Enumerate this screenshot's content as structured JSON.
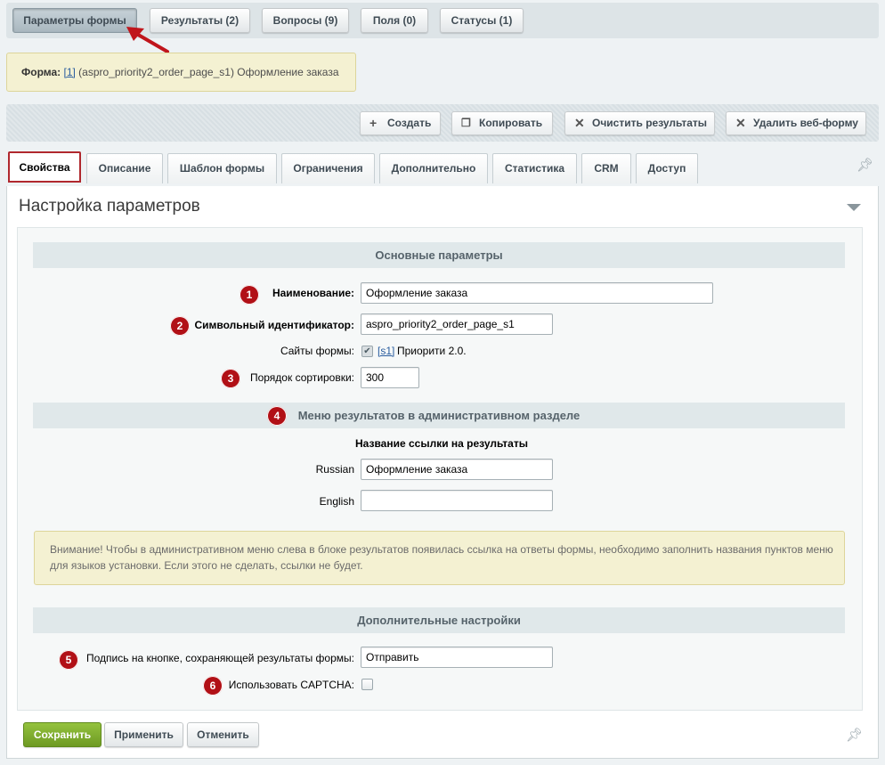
{
  "top_tabs": [
    {
      "label": "Параметры формы",
      "active": true
    },
    {
      "label": "Результаты (2)"
    },
    {
      "label": "Вопросы (9)"
    },
    {
      "label": "Поля (0)"
    },
    {
      "label": "Статусы (1)"
    }
  ],
  "form_info": {
    "prefix": "Форма:",
    "id_link": "[1]",
    "text": "(aspro_priority2_order_page_s1) Оформление заказа"
  },
  "toolbar": {
    "create": "Создать",
    "copy": "Копировать",
    "clear_results": "Очистить результаты",
    "delete_form": "Удалить веб-форму"
  },
  "tabs": [
    {
      "label": "Свойства",
      "active": true
    },
    {
      "label": "Описание"
    },
    {
      "label": "Шаблон формы"
    },
    {
      "label": "Ограничения"
    },
    {
      "label": "Дополнительно"
    },
    {
      "label": "Статистика"
    },
    {
      "label": "CRM"
    },
    {
      "label": "Доступ"
    }
  ],
  "panel_title": "Настройка параметров",
  "sections": {
    "main": "Основные параметры",
    "menu": "Меню результатов в административном разделе",
    "extra": "Дополнительные настройки"
  },
  "fields": {
    "name_label": "Наименование:",
    "name_value": "Оформление заказа",
    "sid_label": "Символьный идентификатор:",
    "sid_value": "aspro_priority2_order_page_s1",
    "sites_label": "Сайты формы:",
    "site_link": "[s1]",
    "site_name": "Приорити 2.0.",
    "sort_label": "Порядок сортировки:",
    "sort_value": "300",
    "results_link_title": "Название ссылки на результаты",
    "russian_label": "Russian",
    "russian_value": "Оформление заказа",
    "english_label": "English",
    "english_value": "",
    "button_caption_label": "Подпись на кнопке, сохраняющей результаты формы:",
    "button_caption_value": "Отправить",
    "captcha_label": "Использовать CAPTCHA:"
  },
  "warning": {
    "line1": "Внимание! Чтобы в административном меню слева в блоке результатов появилась ссылка на ответы формы, необходимо заполнить названия пунктов меню",
    "line2": "для языков установки. Если этого не сделать, ссылки не будет."
  },
  "markers": [
    "1",
    "2",
    "3",
    "4",
    "5",
    "6"
  ],
  "footer": {
    "save": "Сохранить",
    "apply": "Применить",
    "cancel": "Отменить"
  },
  "colors": {
    "marker_red": "#b11016",
    "active_tab_border": "#b0282e",
    "save_green": "#7fae2e"
  },
  "icons": {
    "create": "plus-icon",
    "copy": "copy-icon",
    "clear": "x-icon",
    "delete": "x-icon",
    "pin": "pin-icon",
    "collapse": "triangle-down-icon"
  }
}
